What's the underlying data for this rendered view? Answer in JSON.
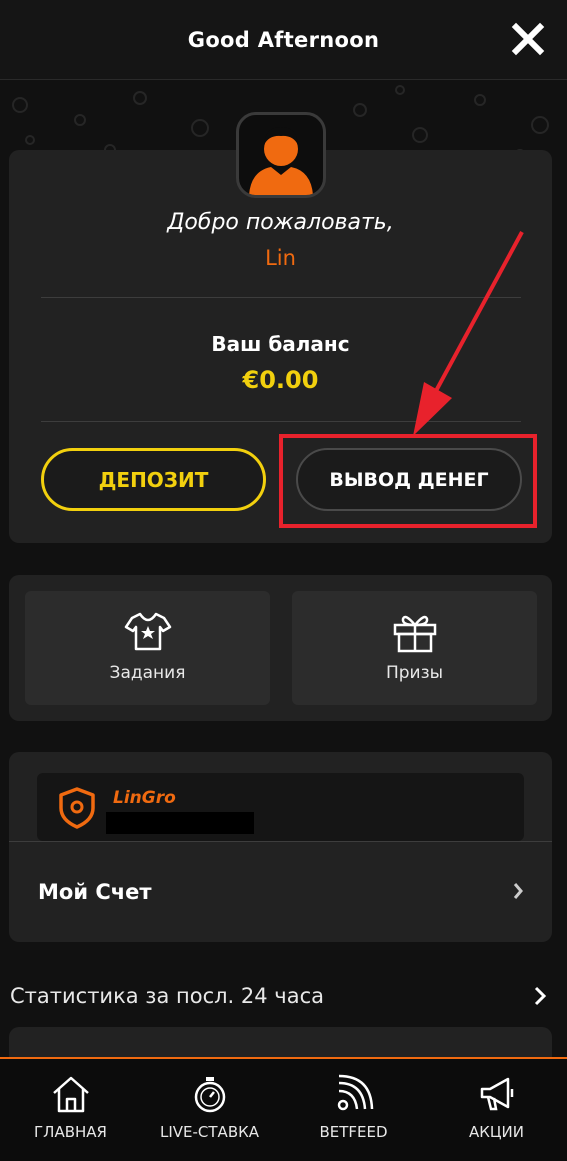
{
  "header": {
    "title": "Good Afternoon"
  },
  "welcome": {
    "greeting": "Добро пожаловать,",
    "username": "Lin",
    "balance_label": "Ваш баланс",
    "balance_value": "€0.00",
    "deposit_label": "ДЕПОЗИТ",
    "withdraw_label": "ВЫВОД ДЕНЕГ"
  },
  "tiles": [
    {
      "label": "Задания",
      "icon": "tshirt-star-icon"
    },
    {
      "label": "Призы",
      "icon": "gift-icon"
    }
  ],
  "account": {
    "brand": "LinGro",
    "brand_icon": "shield-icon",
    "row_label": "Мой Счет"
  },
  "stats": {
    "title": "Статистика за посл. 24 часа"
  },
  "bottom_nav": [
    {
      "label": "ГЛАВНАЯ",
      "icon": "home-icon"
    },
    {
      "label": "LIVE-СТАВКА",
      "icon": "stopwatch-icon"
    },
    {
      "label": "BETFEED",
      "icon": "feed-icon"
    },
    {
      "label": "АКЦИИ",
      "icon": "megaphone-icon"
    }
  ],
  "colors": {
    "accent_orange": "#f06a10",
    "accent_yellow": "#f2d00e",
    "annotation_red": "#e8222c",
    "background": "#111111",
    "card": "#222222"
  }
}
